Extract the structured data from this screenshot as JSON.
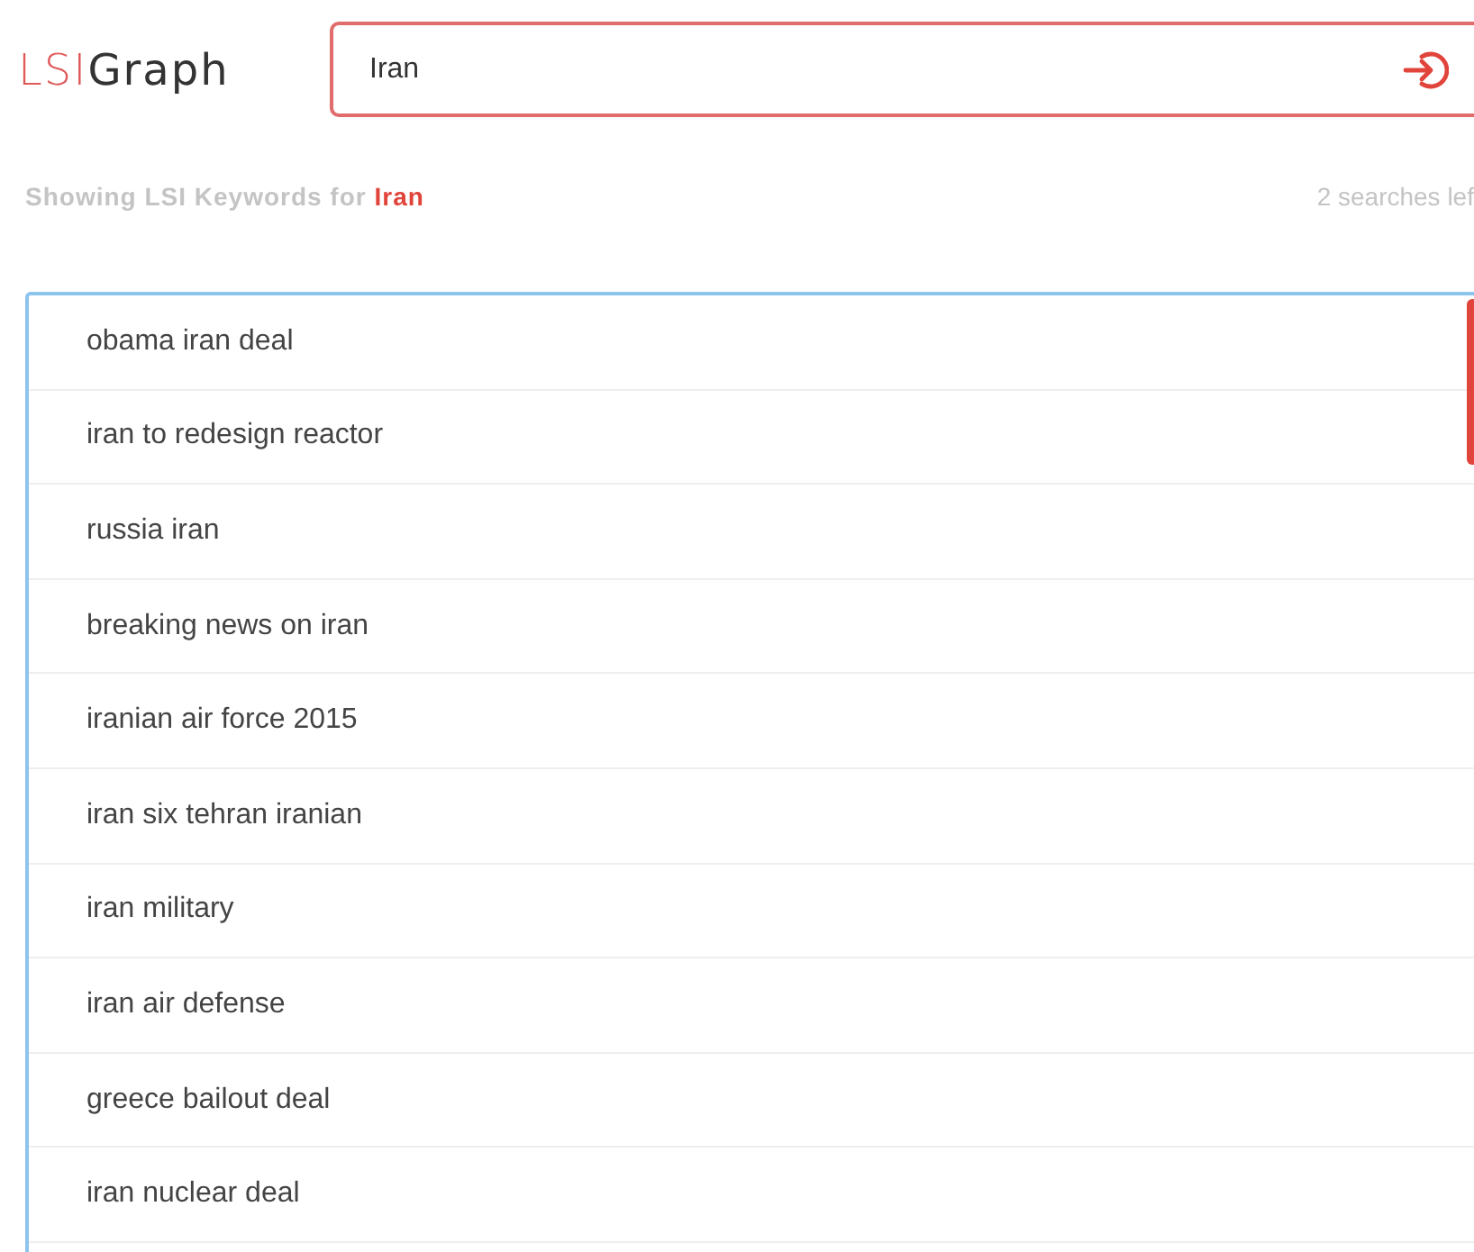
{
  "logo": {
    "part_1": "LSI",
    "part_2": "Graph"
  },
  "search": {
    "value": "Iran"
  },
  "results_header": {
    "label": "Showing LSI Keywords for",
    "query": "Iran",
    "searches_left": "2 searches lef"
  },
  "keywords": [
    {
      "text": "obama iran deal"
    },
    {
      "text": "iran to redesign reactor"
    },
    {
      "text": "russia iran"
    },
    {
      "text": "breaking news on iran"
    },
    {
      "text": "iranian air force 2015"
    },
    {
      "text": "iran six tehran iranian"
    },
    {
      "text": "iran military"
    },
    {
      "text": "iran air defense"
    },
    {
      "text": "greece bailout deal"
    },
    {
      "text": "iran nuclear deal"
    }
  ]
}
